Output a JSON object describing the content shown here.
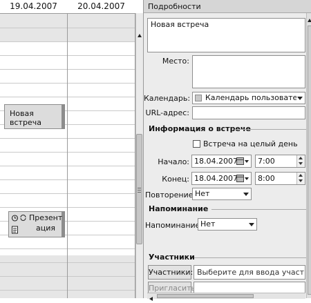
{
  "calendar": {
    "columns": [
      {
        "date": "19.04.2007"
      },
      {
        "date": "20.04.2007"
      }
    ],
    "events": [
      {
        "title": "Новая встреча"
      },
      {
        "title": "Презент ация"
      }
    ]
  },
  "details": {
    "header": "Подробности",
    "title_value": "Новая встреча",
    "location_label": "Место:",
    "calendar_label": "Календарь:",
    "calendar_value": "Календарь пользователя - Ве",
    "url_label": "URL-адрес:",
    "meeting_info_header": "Информация о встрече",
    "all_day_label": "Встреча на целый день",
    "start_label": "Начало:",
    "start_date": "18.04.2007",
    "start_time": "7:00",
    "end_label": "Конец:",
    "end_date": "18.04.2007",
    "end_time": "8:00",
    "repeat_label": "Повторение:",
    "repeat_value": "Нет",
    "reminder_header": "Напоминание",
    "reminder_label": "Напоминание:",
    "reminder_value": "Нет",
    "attendees_header": "Участники",
    "attendees_button": "Участники:",
    "attendees_placeholder": "Выберите для ввода участников",
    "invite_button": "Пригласить"
  },
  "colors": {
    "grid": "#c9c9c9",
    "band": "#e6e6e6",
    "panel": "#ececec"
  }
}
